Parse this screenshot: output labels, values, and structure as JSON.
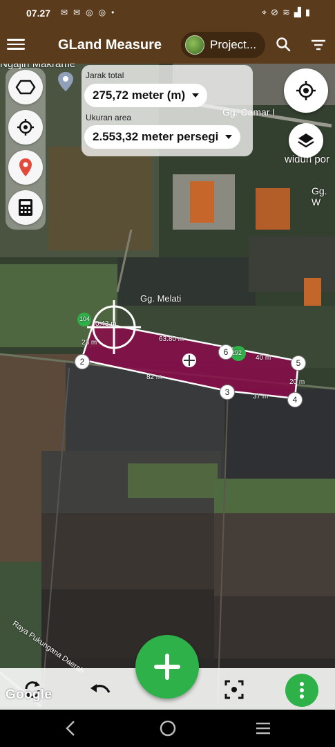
{
  "status": {
    "time": "07.27"
  },
  "appbar": {
    "title": "GLand Measure",
    "project_label": "Project..."
  },
  "measure": {
    "distance_label": "Jarak total",
    "distance_value": "275,72 meter (m)",
    "area_label": "Ukuran area",
    "area_value": "2.553,32 meter persegi"
  },
  "map": {
    "place_labels": [
      "Ngajin Makrame",
      "Gg. Camar I",
      "widuri por",
      "Gg. W",
      "Gg. Melati"
    ],
    "edge_labels": [
      "23 m",
      "63.80 m",
      "40 m",
      "20 m",
      "82 m",
      "37 m",
      "0.43 m"
    ],
    "vertex_labels": [
      "2",
      "3",
      "4",
      "5",
      "6"
    ],
    "side_chips": [
      "104",
      "292"
    ],
    "road_label": "Raya Pukungana Daerah"
  },
  "attribution": "Google",
  "colors": {
    "appbar": "#5a3b1c",
    "polygon": "#8a0a4a",
    "accent": "#2fb149"
  }
}
